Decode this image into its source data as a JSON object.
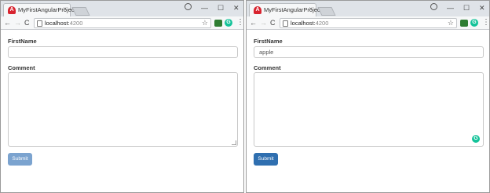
{
  "left_window": {
    "tab_title": "MyFirstAngularProject",
    "tab_close": "×",
    "url_host": "localhost:",
    "url_port": "4200",
    "form": {
      "firstname_label": "FirstName",
      "firstname_value": "",
      "comment_label": "Comment",
      "comment_value": "",
      "submit_label": "Submit",
      "submit_state": "disabled"
    }
  },
  "right_window": {
    "tab_title": "MyFirstAngularProject",
    "tab_close": "×",
    "url_host": "localhost:",
    "url_port": "4200",
    "form": {
      "firstname_label": "FirstName",
      "firstname_value": "apple",
      "comment_label": "Comment",
      "comment_value": "",
      "submit_label": "Submit",
      "submit_state": "enabled"
    }
  },
  "glyphs": {
    "back": "←",
    "forward": "→",
    "reload": "C",
    "star": "☆",
    "minimize": "—",
    "maximize": "☐",
    "close": "✕",
    "menu": "⋮",
    "angular_logo": "A",
    "grammarly": "G"
  },
  "colors": {
    "submit_disabled": "#7ba3cf",
    "submit_enabled": "#2f6fb0",
    "grammarly": "#15c39a",
    "angular": "#d8242f"
  }
}
